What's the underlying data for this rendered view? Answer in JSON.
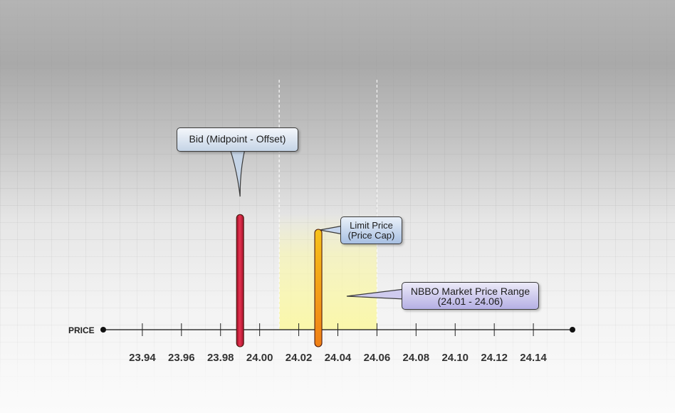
{
  "chart_data": {
    "type": "diagram",
    "axis_label": "PRICE",
    "ticks": [
      "23.94",
      "23.96",
      "23.98",
      "24.00",
      "24.02",
      "24.04",
      "24.06",
      "24.08",
      "24.10",
      "24.12",
      "24.14"
    ],
    "tick_values": [
      23.94,
      23.96,
      23.98,
      24.0,
      24.02,
      24.04,
      24.06,
      24.08,
      24.1,
      24.12,
      24.14
    ],
    "x_range": [
      23.92,
      24.16
    ],
    "markers": [
      {
        "value": 23.99,
        "color": "#d91f3f",
        "strength": 0.79,
        "callout_lines": [
          "Bid (Midpoint - Offset)"
        ]
      },
      {
        "value": 24.03,
        "color": "#f0a500",
        "strength": 0.7,
        "callout_lines": [
          "Limit Price",
          "(Price Cap)"
        ]
      }
    ],
    "range": {
      "low": 24.01,
      "high": 24.06,
      "color": "#fbf9b4",
      "callout_lines": [
        "NBBO Market Price Range",
        "(24.01 - 24.06)"
      ]
    }
  }
}
